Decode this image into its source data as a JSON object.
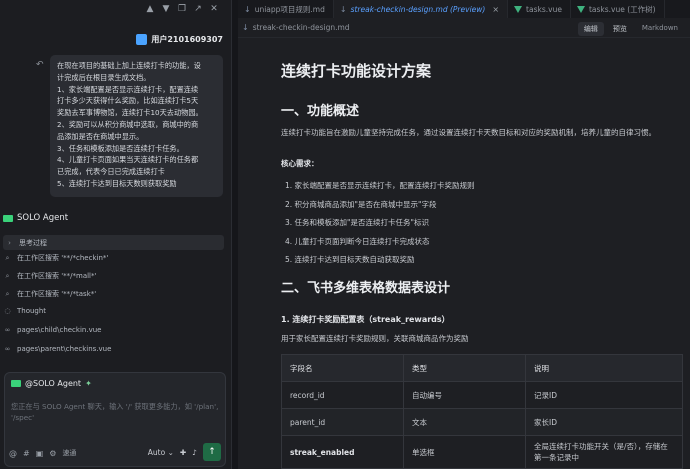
{
  "left": {
    "user_name": "用户2101609307",
    "message_lines": [
      "在现在项目的基础上加上连续打卡的功能，设",
      "计完成后在根目录生成文档。",
      "1、家长端配置是否显示连续打卡，配置连续",
      "打卡多少天获得什么奖励，比如连续打卡5天",
      "奖励去军事博物馆，连续打卡10天去动物园。",
      "2、奖励可以从积分商城中选取，商城中的商",
      "品添加是否在商城中显示。",
      "3、任务和模板添加是否连续打卡任务。",
      "4、儿童打卡页面如果当天连续打卡的任务都",
      "已完成，代表今日已完成连续打卡",
      "5、连续打卡达到目标天数则获取奖励"
    ],
    "agent_title": "SOLO Agent",
    "steps": [
      {
        "icon": "chevron-right-icon",
        "glyph": "›",
        "text": "思考过程"
      },
      {
        "icon": "search-icon",
        "glyph": "⌕",
        "text": "在工作区搜索 '**/*checkin*'"
      },
      {
        "icon": "search-icon",
        "glyph": "⌕",
        "text": "在工作区搜索 '**/*mall*'"
      },
      {
        "icon": "search-icon",
        "glyph": "⌕",
        "text": "在工作区搜索 '**/*task*'"
      },
      {
        "icon": "thought-icon",
        "glyph": "◌",
        "text": "Thought"
      },
      {
        "icon": "file-view-icon",
        "glyph": "∞",
        "text": "pages\\child\\checkin.vue"
      },
      {
        "icon": "file-view-icon",
        "glyph": "∞",
        "text": "pages\\parent\\checkins.vue"
      }
    ],
    "chat": {
      "mention": "@SOLO Agent",
      "placeholder": "您正在与 SOLO Agent 聊天，输入 '/' 获取更多能力，如 '/plan', '/spec'",
      "mode_chip": "速通",
      "model": "Auto"
    }
  },
  "right": {
    "tabs": [
      {
        "label": "uniapp项目规则.md",
        "type": "md",
        "active": false
      },
      {
        "label": "streak-checkin-design.md (Preview)",
        "type": "md",
        "active": true
      },
      {
        "label": "tasks.vue",
        "type": "vue",
        "active": false
      },
      {
        "label": "tasks.vue (工作树)",
        "type": "vue",
        "active": false
      }
    ],
    "breadcrumb": "streak-checkin-design.md",
    "modes": [
      "编辑",
      "预览",
      "Markdown"
    ],
    "doc": {
      "title": "连续打卡功能设计方案",
      "s1_title": "一、功能概述",
      "s1_para": "连续打卡功能旨在激励儿童坚持完成任务，通过设置连续打卡天数目标和对应的奖励机制，培养儿童的自律习惯。",
      "core_label": "核心需求：",
      "core_items": [
        "1.  家长端配置是否显示连续打卡，配置连续打卡奖励规则",
        "2.  积分商城商品添加\"是否在商城中显示\"字段",
        "3.  任务和模板添加\"是否连续打卡任务\"标识",
        "4.  儿童打卡页面判断今日连续打卡完成状态",
        "5.  连续打卡达到目标天数自动获取奖励"
      ],
      "s2_title": "二、飞书多维表格数据表设计",
      "table1_title": "1. 连续打卡奖励配置表（streak_rewards）",
      "table1_desc": "用于家长配置连续打卡奖励规则，关联商城商品作为奖励",
      "table_head": [
        "字段名",
        "类型",
        "说明"
      ],
      "table_rows": [
        [
          "record_id",
          "自动编号",
          "记录ID"
        ],
        [
          "parent_id",
          "文本",
          "家长ID"
        ],
        [
          "streak_enabled",
          "单选框",
          "全局连续打卡功能开关（是/否），存储在第一条记录中"
        ]
      ]
    }
  }
}
